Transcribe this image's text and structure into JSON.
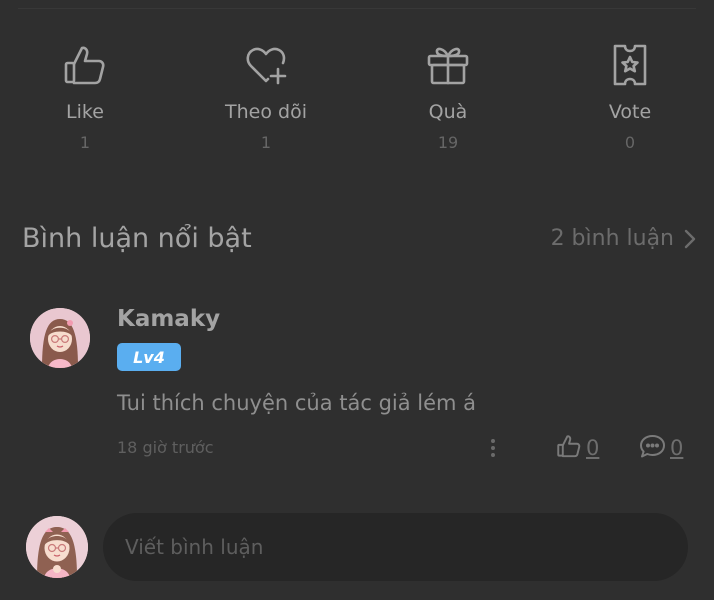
{
  "actions": [
    {
      "icon": "like-icon",
      "label": "Like",
      "count": "1"
    },
    {
      "icon": "heart-plus-icon",
      "label": "Theo dõi",
      "count": "1"
    },
    {
      "icon": "gift-icon",
      "label": "Quà",
      "count": "19"
    },
    {
      "icon": "vote-ticket-icon",
      "label": "Vote",
      "count": "0"
    }
  ],
  "section": {
    "title": "Bình luận nổi bật",
    "see_all": "2 bình luận"
  },
  "comment": {
    "author": "Kamaky",
    "level": "Lv4",
    "text": "Tui thích chuyện của tác giả lém á",
    "time": "18 giờ trước",
    "likes": "0",
    "replies": "0"
  },
  "composer": {
    "placeholder": "Viết bình luận"
  },
  "colors": {
    "background": "#2f2f2f",
    "level_badge": "#5aaef0",
    "input_background": "#262626"
  }
}
